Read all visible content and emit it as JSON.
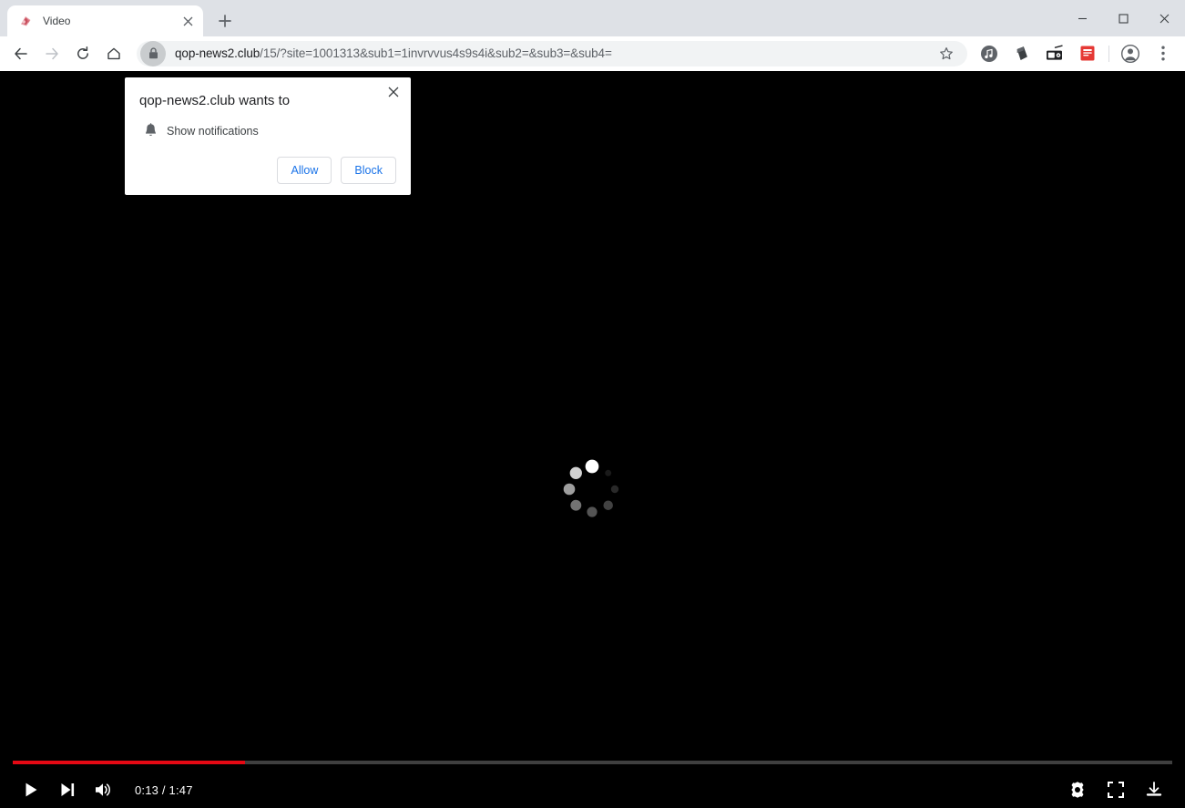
{
  "window": {
    "minimize_label": "Minimize",
    "maximize_label": "Maximize",
    "close_label": "Close"
  },
  "tabstrip": {
    "tabs": [
      {
        "title": "Video",
        "favicon": "video-site-favicon",
        "close_label": "×"
      }
    ],
    "new_tab_label": "+"
  },
  "toolbar": {
    "back_label": "Back",
    "forward_label": "Forward",
    "reload_label": "Reload",
    "home_label": "Home",
    "url_host": "qop-news2.club",
    "url_path": "/15/?site=1001313&sub1=1invrvvus4s9s4i&sub2=&sub3=&sub4=",
    "url_full": "qop-news2.club/15/?site=1001313&sub1=1invrvvus4s9s4i&sub2=&sub3=&sub4=",
    "lock_icon": "lock-icon",
    "bookmark_label": "Bookmark this tab",
    "extensions": [
      {
        "name": "music-extension-icon",
        "color": "#5f6368"
      },
      {
        "name": "dark-page-extension-icon",
        "color": "#3c4043"
      },
      {
        "name": "radio-extension-icon",
        "color": "#202124"
      },
      {
        "name": "red-extension-icon",
        "color": "#e53935"
      }
    ],
    "profile_label": "Profile",
    "menu_label": "Customize and control Google Chrome"
  },
  "permission_dialog": {
    "title": "qop-news2.club wants to",
    "permission_icon": "bell-icon",
    "permission_label": "Show notifications",
    "allow_label": "Allow",
    "block_label": "Block",
    "close_label": "×"
  },
  "player": {
    "state": "loading",
    "spinner_icon": "loading-spinner-icon",
    "play_label": "Play",
    "next_label": "Next",
    "volume_label": "Mute",
    "time_display": "0:13 / 1:47",
    "current_time": "0:13",
    "duration": "1:47",
    "progress_percent": 20,
    "settings_label": "Settings",
    "fullscreen_label": "Full screen",
    "download_label": "Download",
    "progress_color": "#e50914",
    "track_color": "#3f3f3f"
  }
}
